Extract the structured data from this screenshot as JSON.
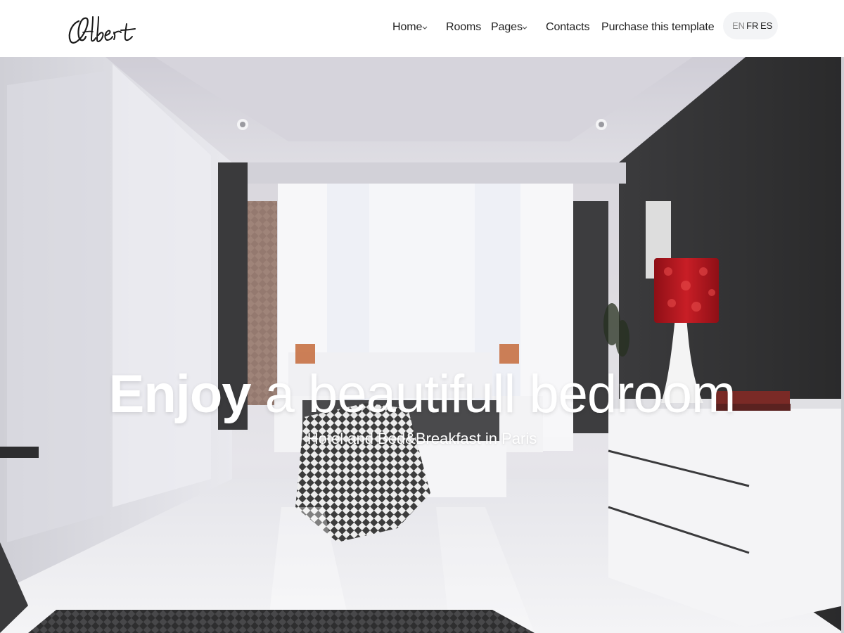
{
  "brand": {
    "name": "Albert"
  },
  "nav": {
    "items": [
      {
        "label": "Home",
        "has_dropdown": true
      },
      {
        "label": "Rooms",
        "has_dropdown": false
      },
      {
        "label": "Pages",
        "has_dropdown": true
      },
      {
        "label": "Contacts",
        "has_dropdown": false
      },
      {
        "label": "Purchase this template",
        "has_dropdown": false
      }
    ],
    "dropdown_icon": "chevron-down-icon"
  },
  "languages": {
    "options": [
      "EN",
      "FR",
      "ES"
    ],
    "inactive": [
      "EN"
    ],
    "active": [
      "FR",
      "ES"
    ]
  },
  "hero": {
    "title_strong": "Enjoy",
    "title_rest": "a beautifull bedroom",
    "subtitle": "Hotel and Bed&Breakfast in Paris",
    "background": "bedroom-photo"
  },
  "colors": {
    "header_bg": "#ffffff",
    "nav_text": "#222222",
    "lang_pill_bg": "#f3f4f6",
    "hero_text": "#ffffff",
    "lamp_red": "#b3141c"
  }
}
